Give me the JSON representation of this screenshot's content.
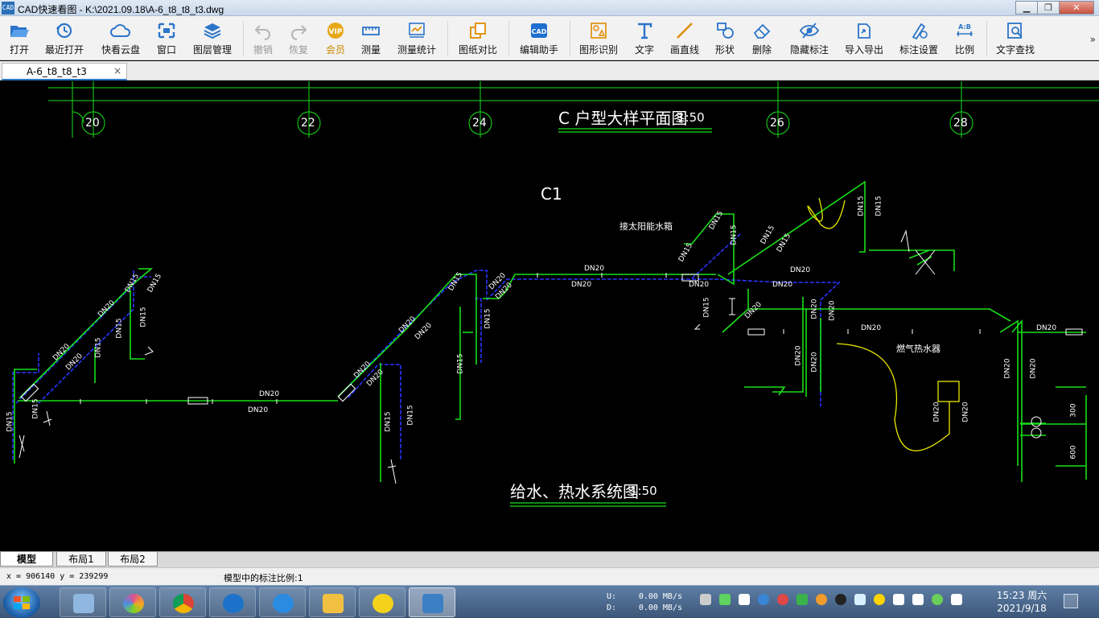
{
  "window": {
    "icon_label": "CAD",
    "title": "CAD快速看图 - K:\\2021.09.18\\A-6_t8_t8_t3.dwg",
    "controls": [
      "minimize",
      "restore",
      "close"
    ]
  },
  "toolbar": {
    "items": [
      {
        "label": "打开",
        "icon": "folder-open-icon"
      },
      {
        "label": "最近打开",
        "icon": "history-clock-icon"
      },
      {
        "label": "快看云盘",
        "icon": "cloud-icon"
      },
      {
        "label": "窗口",
        "icon": "window-frame-icon"
      },
      {
        "label": "图层管理",
        "icon": "layers-icon"
      },
      {
        "label": "撤销",
        "icon": "undo-arrow-icon",
        "disabled": true
      },
      {
        "label": "恢复",
        "icon": "redo-arrow-icon",
        "disabled": true
      },
      {
        "label": "会员",
        "icon": "vip-badge-icon",
        "vip": true
      },
      {
        "label": "测量",
        "icon": "ruler-icon"
      },
      {
        "label": "测量统计",
        "icon": "measure-stats-icon"
      },
      {
        "label": "图纸对比",
        "icon": "compare-sheets-icon"
      },
      {
        "label": "编辑助手",
        "icon": "edit-assistant-icon"
      },
      {
        "label": "图形识别",
        "icon": "shape-recognize-icon"
      },
      {
        "label": "文字",
        "icon": "text-t-icon"
      },
      {
        "label": "画直线",
        "icon": "draw-line-icon"
      },
      {
        "label": "形状",
        "icon": "shapes-icon"
      },
      {
        "label": "删除",
        "icon": "eraser-icon"
      },
      {
        "label": "隐藏标注",
        "icon": "hide-eye-icon"
      },
      {
        "label": "导入导出",
        "icon": "import-export-icon"
      },
      {
        "label": "标注设置",
        "icon": "annotation-settings-icon"
      },
      {
        "label": "比例",
        "icon": "scale-ab-icon"
      },
      {
        "label": "文字查找",
        "icon": "text-search-icon"
      }
    ],
    "more_glyph": "»"
  },
  "document_tab": {
    "label": "A-6_t8_t8_t3",
    "close_glyph": "×"
  },
  "drawing": {
    "axis_labels": [
      "20",
      "22",
      "24",
      "26",
      "28"
    ],
    "plan_title": "C 户型大样平面图",
    "plan_scale": "1:50",
    "block_label": "C1",
    "system_title": "给水、热水系统图",
    "system_scale": "1:50",
    "solar_tank_label": "接太阳能水箱",
    "gas_heater_label": "燃气热水器",
    "pipe_labels": {
      "dn20": "DN20",
      "dn15": "DN15"
    },
    "dims": {
      "d300": "300",
      "d600": "600"
    }
  },
  "layout_tabs": [
    "模型",
    "布局1",
    "布局2"
  ],
  "status": {
    "coords": "x = 906140  y = 239299",
    "scale_text": "模型中的标注比例:1"
  },
  "taskbar": {
    "apps": [
      {
        "name": "calculator",
        "color": "#8fb7e0"
      },
      {
        "name": "photo-viewer",
        "color": "#e04f8f"
      },
      {
        "name": "chrome",
        "color": "#e9b52a"
      },
      {
        "name": "e-browser",
        "color": "#1c72c9"
      },
      {
        "name": "feather-app",
        "color": "#2b8be0"
      },
      {
        "name": "folder",
        "color": "#f2c041"
      },
      {
        "name": "x-tool",
        "color": "#f4d21c"
      },
      {
        "name": "cad-viewer",
        "color": "#3d7fc4",
        "active": true
      }
    ],
    "net_up_label": "U:",
    "net_down_label": "D:",
    "net_up": "0.00 MB/s",
    "net_down": "0.00 MB/s",
    "tray_colors": [
      "#cccccc",
      "#5fd35f",
      "#ffffff",
      "#3a86d6",
      "#e04848",
      "#3ab34a",
      "#f19b2c",
      "#ffd400",
      "#222222",
      "#d8f0ff",
      "#ffffff",
      "#ffffff",
      "#6bcf5a",
      "#ffffff"
    ],
    "clock_time": "15:23 周六",
    "clock_date": "2021/9/18"
  },
  "colors": {
    "pipe_green": "#18e018",
    "pipe_blue": "#2a35ff",
    "cad_yellow": "#e8e800",
    "cad_white": "#ffffff"
  }
}
